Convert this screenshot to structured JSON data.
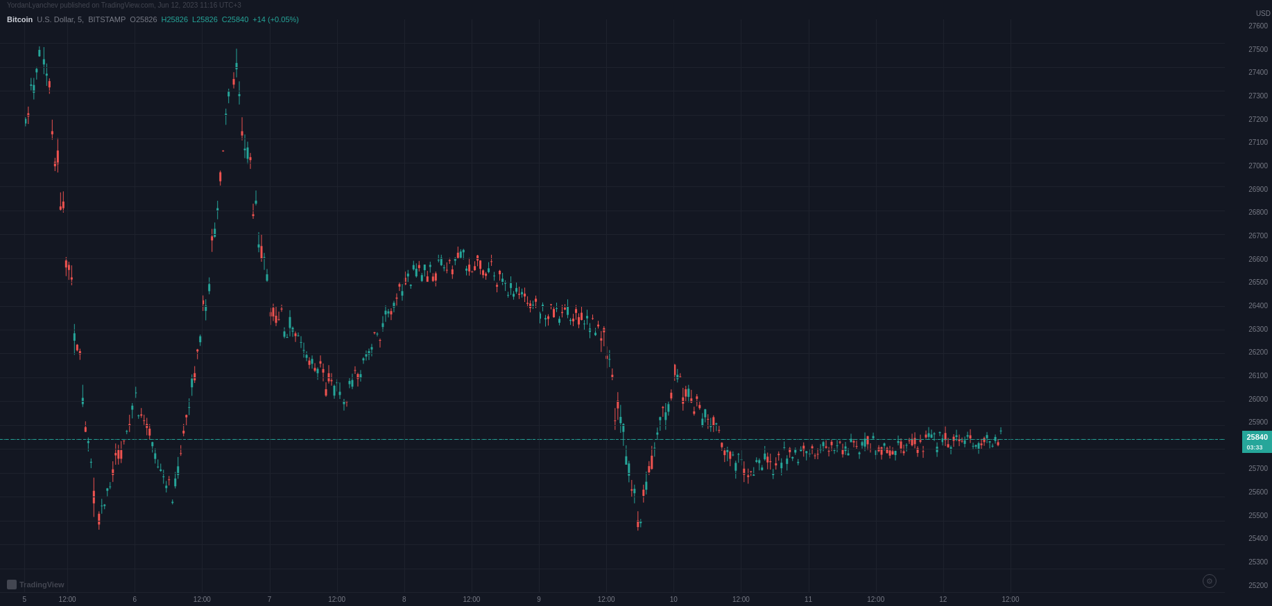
{
  "header": {
    "published_by": "YordanLyanchev published on TradingView.com, Jun 12, 2023 11:16 UTC+3",
    "symbol": "Bitcoin",
    "pair": "U.S. Dollar, 5,",
    "exchange": "BITSTAMP",
    "open_label": "O",
    "open_value": "25826",
    "high_label": "H",
    "high_value": "25826",
    "low_label": "L",
    "low_value": "25826",
    "close_label": "C",
    "close_value": "25840",
    "change": "+14 (+0.05%)"
  },
  "price_axis": {
    "labels": [
      "27600",
      "27500",
      "27400",
      "27300",
      "27200",
      "27100",
      "27000",
      "26900",
      "26800",
      "26700",
      "26600",
      "26500",
      "26400",
      "26300",
      "26200",
      "26100",
      "26000",
      "25900",
      "25800",
      "25700",
      "25600",
      "25500",
      "25400",
      "25300",
      "25200"
    ],
    "currency": "USD"
  },
  "current_price": {
    "value": "25840",
    "time": "03:33"
  },
  "time_axis": {
    "labels": [
      {
        "text": "5",
        "pct": 2
      },
      {
        "text": "12:00",
        "pct": 5.5
      },
      {
        "text": "6",
        "pct": 11
      },
      {
        "text": "12:00",
        "pct": 16.5
      },
      {
        "text": "7",
        "pct": 22
      },
      {
        "text": "12:00",
        "pct": 27.5
      },
      {
        "text": "8",
        "pct": 33
      },
      {
        "text": "12:00",
        "pct": 38.5
      },
      {
        "text": "9",
        "pct": 44
      },
      {
        "text": "12:00",
        "pct": 49.5
      },
      {
        "text": "10",
        "pct": 55
      },
      {
        "text": "12:00",
        "pct": 60.5
      },
      {
        "text": "11",
        "pct": 66
      },
      {
        "text": "12:00",
        "pct": 71.5
      },
      {
        "text": "12",
        "pct": 77
      },
      {
        "text": "12:00",
        "pct": 82.5
      }
    ]
  },
  "chart": {
    "price_min": 25200,
    "price_max": 27600,
    "current_price": 25840,
    "accent_color": "#26a69a",
    "down_color": "#ef5350",
    "bg_color": "#131722",
    "grid_color": "#1e222d"
  },
  "watermark": {
    "currency_label": "USD"
  },
  "tradingview": {
    "logo_text": "TradingView"
  }
}
